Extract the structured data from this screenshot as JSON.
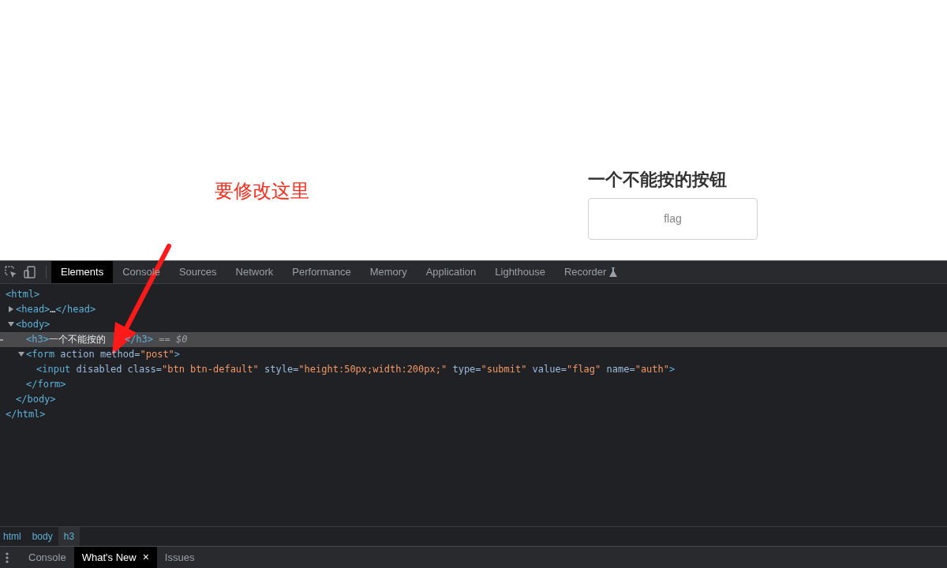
{
  "annotation": {
    "text": "要修改这里"
  },
  "page": {
    "heading": "一个不能按的按钮",
    "button": {
      "value": "flag",
      "disabled": true
    }
  },
  "devtools": {
    "tabs": [
      {
        "label": "Elements",
        "selected": true
      },
      {
        "label": "Console",
        "selected": false
      },
      {
        "label": "Sources",
        "selected": false
      },
      {
        "label": "Network",
        "selected": false
      },
      {
        "label": "Performance",
        "selected": false
      },
      {
        "label": "Memory",
        "selected": false
      },
      {
        "label": "Application",
        "selected": false
      },
      {
        "label": "Lighthouse",
        "selected": false
      },
      {
        "label": "Recorder",
        "selected": false
      }
    ],
    "dom_tree": [
      {
        "tokens": [
          {
            "kind": "tag",
            "text": "<html>"
          }
        ],
        "closing": [
          {
            "kind": "tag",
            "text": "</html>"
          }
        ],
        "children": [
          {
            "tokens": [
              {
                "kind": "tag",
                "text": "<head>"
              },
              {
                "kind": "text",
                "text": "…"
              },
              {
                "kind": "tag",
                "text": "</head>"
              }
            ],
            "expanded": false
          },
          {
            "tokens": [
              {
                "kind": "tag",
                "text": "<body>"
              }
            ],
            "expanded": true,
            "closing": [
              {
                "kind": "tag",
                "text": "</body>"
              }
            ],
            "children": [
              {
                "tokens": [
                  {
                    "kind": "tag",
                    "text": "<h3>"
                  },
                  {
                    "kind": "text",
                    "text": "一个不能按的"
                  },
                  {
                    "kind": "covered"
                  },
                  {
                    "kind": "tag",
                    "text": "</h3>"
                  },
                  {
                    "kind": "marker",
                    "text": " == $0"
                  }
                ],
                "selected": true
              },
              {
                "tokens": [
                  {
                    "kind": "tag",
                    "text": "<form"
                  },
                  {
                    "kind": "attr",
                    "text": " action method="
                  },
                  {
                    "kind": "value",
                    "text": "\"post\""
                  },
                  {
                    "kind": "tag",
                    "text": ">"
                  }
                ],
                "expanded": true,
                "closing": [
                  {
                    "kind": "tag",
                    "text": "</form>"
                  }
                ],
                "children": [
                  {
                    "tokens": [
                      {
                        "kind": "tag",
                        "text": "<input"
                      },
                      {
                        "kind": "attr",
                        "text": " disabled class="
                      },
                      {
                        "kind": "value",
                        "text": "\"btn btn-default\""
                      },
                      {
                        "kind": "attr",
                        "text": " style="
                      },
                      {
                        "kind": "value",
                        "text": "\"height:50px;width:200px;\""
                      },
                      {
                        "kind": "attr",
                        "text": " type="
                      },
                      {
                        "kind": "value",
                        "text": "\"submit\""
                      },
                      {
                        "kind": "attr",
                        "text": " value="
                      },
                      {
                        "kind": "value",
                        "text": "\"flag\""
                      },
                      {
                        "kind": "attr",
                        "text": " name="
                      },
                      {
                        "kind": "value",
                        "text": "\"auth\""
                      },
                      {
                        "kind": "tag",
                        "text": ">"
                      }
                    ]
                  }
                ]
              }
            ]
          }
        ]
      }
    ],
    "breadcrumbs": [
      {
        "label": "html",
        "selected": false
      },
      {
        "label": "body",
        "selected": false
      },
      {
        "label": "h3",
        "selected": true
      }
    ],
    "drawer_tabs": [
      {
        "label": "Console",
        "selected": false,
        "closable": false
      },
      {
        "label": "What's New",
        "selected": true,
        "closable": true,
        "close": "×"
      },
      {
        "label": "Issues",
        "selected": false,
        "closable": false
      }
    ]
  }
}
